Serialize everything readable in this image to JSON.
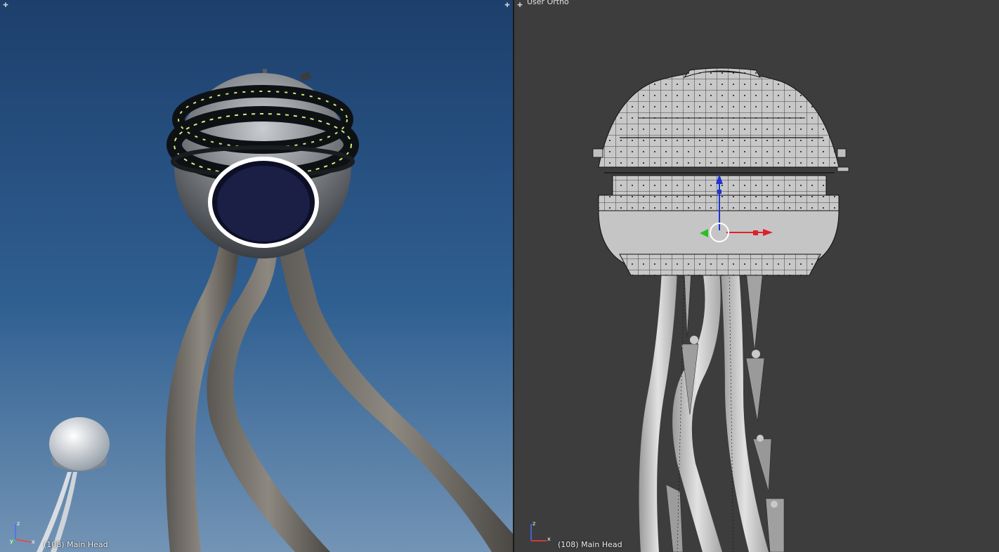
{
  "left_viewport": {
    "status_text": "(108) Main Head",
    "axis": {
      "z": "z",
      "x": "x",
      "y": "y"
    }
  },
  "right_viewport": {
    "header_text": "User Ortho",
    "status_text": "(108) Main Head",
    "axis": {
      "z": "z",
      "x": "x"
    }
  },
  "colors": {
    "sky_top": "#1d3f6c",
    "sky_bottom": "#6e8fb2",
    "viewport_bg": "#3d3d3d",
    "manipulator_red": "#e0202a",
    "manipulator_green": "#28c028",
    "manipulator_blue": "#1c33d6"
  }
}
